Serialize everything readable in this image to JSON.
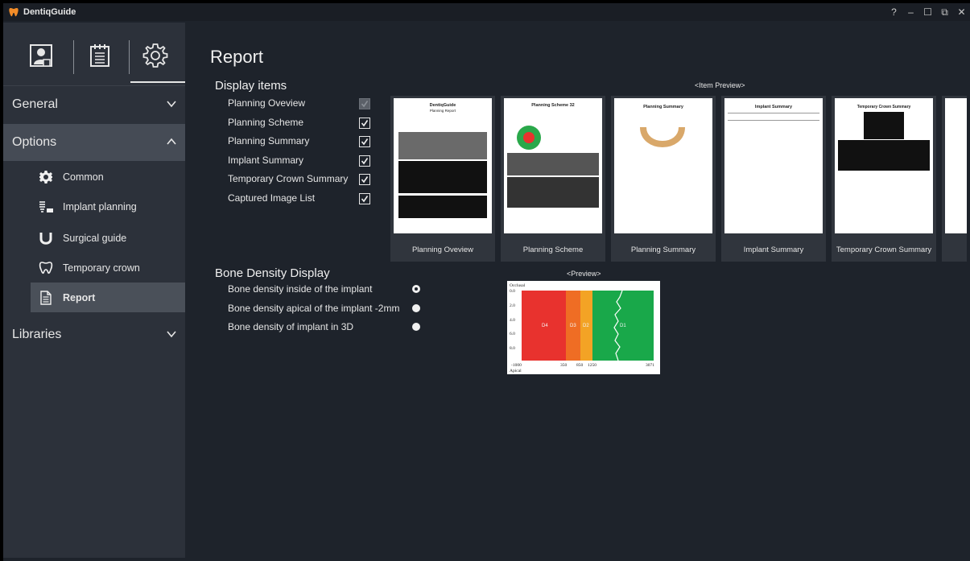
{
  "app": {
    "title": "DentiqGuide"
  },
  "window_controls": [
    "?",
    "–",
    "☐",
    "⧉",
    "✕"
  ],
  "sidebar": {
    "top_icons": [
      "user-profile-icon",
      "calendar-icon",
      "gear-icon"
    ],
    "sections": [
      {
        "label": "General",
        "expanded": false
      },
      {
        "label": "Options",
        "expanded": true
      },
      {
        "label": "Libraries",
        "expanded": false
      }
    ],
    "options_items": [
      {
        "label": "Common",
        "icon": "gear-icon"
      },
      {
        "label": "Implant planning",
        "icon": "implant-icon"
      },
      {
        "label": "Surgical guide",
        "icon": "surgical-guide-icon"
      },
      {
        "label": "Temporary crown",
        "icon": "crown-icon"
      },
      {
        "label": "Report",
        "icon": "report-icon",
        "active": true
      }
    ]
  },
  "main": {
    "title": "Report",
    "display_items": {
      "title": "Display items",
      "items": [
        {
          "label": "Planning Oveview",
          "checked": true,
          "disabled": true
        },
        {
          "label": "Planning Scheme",
          "checked": true
        },
        {
          "label": "Planning Summary",
          "checked": true
        },
        {
          "label": "Implant Summary",
          "checked": true
        },
        {
          "label": "Temporary Crown Summary",
          "checked": true
        },
        {
          "label": "Captured Image List",
          "checked": true
        }
      ]
    },
    "item_preview": {
      "label": "<Item Preview>",
      "thumbnails": [
        {
          "caption": "Planning Oveview",
          "page_heading": "DentiqGuide",
          "page_subheading": "Planning Report"
        },
        {
          "caption": "Planning Scheme",
          "page_heading": "Planning Scheme 32"
        },
        {
          "caption": "Planning Summary",
          "page_heading": "Planning Summary"
        },
        {
          "caption": "Implant Summary",
          "page_heading": "Implant Summary"
        },
        {
          "caption": "Temporary Crown Summary",
          "page_heading": "Temporary Crown Summary"
        }
      ]
    },
    "bone_density": {
      "title": "Bone Density Display",
      "options": [
        {
          "label": "Bone density inside of the implant",
          "selected": true
        },
        {
          "label": "Bone density apical of the implant -2mm",
          "selected": false
        },
        {
          "label": "Bone density of implant in 3D",
          "selected": false
        }
      ],
      "preview_label": "<Preview>",
      "chart": {
        "top_label": "Occlusal",
        "bottom_label": "Apical",
        "y_ticks": [
          "0.0",
          "2.0",
          "4.0",
          "6.0",
          "8.0"
        ],
        "x_ticks": [
          "-1000",
          "350",
          "850",
          "1250",
          "3071"
        ],
        "zones": [
          {
            "label": "D4",
            "color": "#e8322e"
          },
          {
            "label": "D3",
            "color": "#ef6d24"
          },
          {
            "label": "D2",
            "color": "#f3a325"
          },
          {
            "label": "D1",
            "color": "#19a84a"
          }
        ]
      }
    }
  },
  "colors": {
    "background": "#1e232b",
    "sidebar": "#2c313a",
    "active_item": "#4a5059",
    "accent": "#f28c28"
  }
}
